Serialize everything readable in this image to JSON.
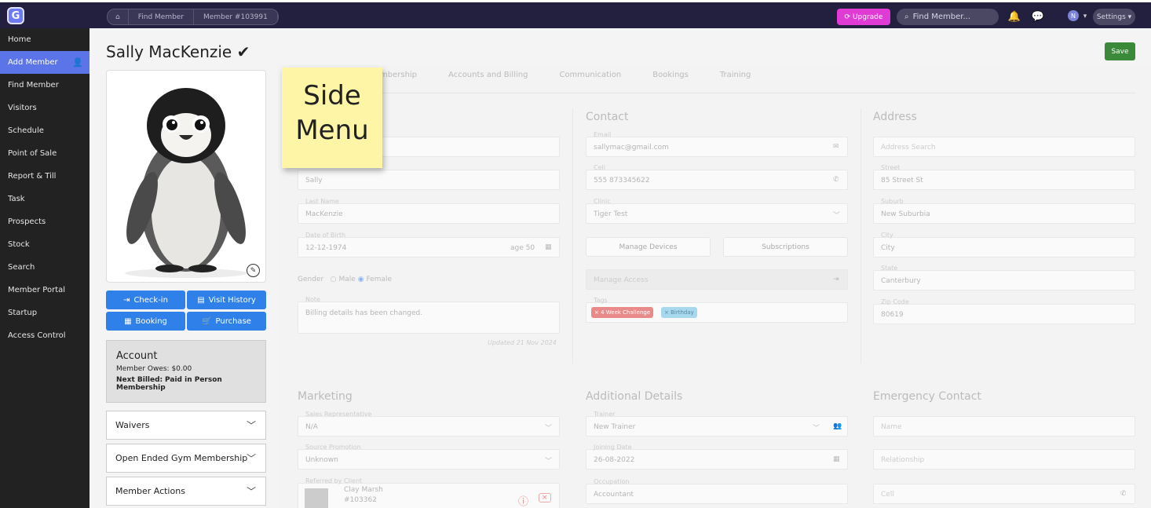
{
  "topbar": {
    "logo": "G",
    "breadcrumb": [
      "⌂",
      "Find Member",
      "Member #103991"
    ],
    "upgrade": "⟳ Upgrade",
    "find_placeholder": "Find Member...",
    "avatar": "N",
    "settings": "Settings ▾"
  },
  "sidebar": [
    "Home",
    "Add Member",
    "Find Member",
    "Visitors",
    "Schedule",
    "Point of Sale",
    "Report & Till",
    "Task",
    "Prospects",
    "Stock",
    "Search",
    "Member Portal",
    "Startup",
    "Access Control"
  ],
  "member": {
    "name": "Sally MacKenzie ✔",
    "save": "Save"
  },
  "actions": {
    "checkin": "Check-in",
    "visit_history": "Visit History",
    "booking": "Booking",
    "purchase": "Purchase"
  },
  "account": {
    "title": "Account",
    "owes": "Member Owes: $0.00",
    "next_billed_label": "Next Billed:",
    "next_billed_value": "Paid in Person Membership"
  },
  "collapsibles": [
    "Waivers",
    "Open Ended Gym Membership",
    "Member Actions"
  ],
  "tabs": [
    "mbership",
    "Accounts and Billing",
    "Communication",
    "Bookings",
    "Training"
  ],
  "sticky_note": [
    "Side",
    "Menu"
  ],
  "personal": {
    "first_name": "Sally",
    "last_name_label": "Last Name",
    "last_name": "MacKenzie",
    "dob_label": "Date of Birth",
    "dob": "12-12-1974",
    "age": "age 50",
    "gender_label": "Gender",
    "male": "Male",
    "female": "Female",
    "note_label": "Note",
    "note": "Billing details has been changed.",
    "updated": "Updated 21 Nov 2024"
  },
  "contact": {
    "title": "Contact",
    "email_label": "Email",
    "email": "sallymac@gmail.com",
    "cell_label": "Cell",
    "cell": "555 873345622",
    "clinic_label": "Clinic",
    "clinic": "Tiger Test",
    "manage_devices": "Manage Devices",
    "subscriptions": "Subscriptions",
    "manage_access": "Manage Access",
    "tags_label": "Tags",
    "tag1": "× 4 Week Challenge",
    "tag2": "× Birthday"
  },
  "address": {
    "title": "Address",
    "search": "Address Search",
    "street_label": "Street",
    "street": "85 Street St",
    "suburb_label": "Suburb",
    "suburb": "New Suburbia",
    "city_label": "City",
    "city": "City",
    "state_label": "State",
    "state": "Canterbury",
    "zip_label": "Zip Code",
    "zip": "80619"
  },
  "marketing": {
    "title": "Marketing",
    "rep_label": "Sales Representative",
    "rep": "N/A",
    "promo_label": "Source Promotion",
    "promo": "Unknown",
    "referred_label": "Referred by Client",
    "ref_name": "Clay Marsh",
    "ref_id": "#103362"
  },
  "additional": {
    "title": "Additional Details",
    "trainer_label": "Trainer",
    "trainer": "New Trainer",
    "joining_label": "Joining Date",
    "joining": "26-08-2022",
    "occupation_label": "Occupation",
    "occupation": "Accountant"
  },
  "emergency": {
    "title": "Emergency Contact",
    "name": "Name",
    "relationship": "Relationship",
    "cell": "Cell"
  }
}
